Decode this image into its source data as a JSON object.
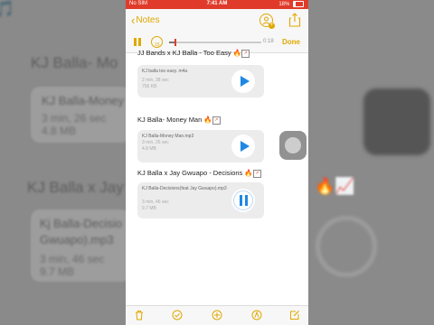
{
  "status_bar": {
    "carrier": "No SIM",
    "time": "7:41 AM",
    "battery": "18%"
  },
  "nav": {
    "back_label": "Notes",
    "icons": [
      "chevron-left-icon",
      "add-person-icon",
      "share-icon"
    ]
  },
  "player": {
    "elapsed": "0:18",
    "done_label": "Done",
    "progress": 0.06
  },
  "note": {
    "top_heading_partial": "JJ Bands x KJ Balla - Too Easy",
    "items": [
      {
        "heading": "",
        "file_name": "KJ balla too easy. m4a",
        "duration": "2 min, 38 sec",
        "size": "756 KB",
        "state": "play"
      },
      {
        "heading": "KJ Balla- Money Man",
        "file_name": "KJ Balla-Money Man.mp3",
        "duration": "3 min, 26 sec",
        "size": "4.8 MB",
        "state": "play"
      },
      {
        "heading": "KJ Balla x Jay Gwuapo - Decisions",
        "file_name": "KJ Balla-Decisions(feat Jay Gwuapo).mp3",
        "duration": "3 min, 46 sec",
        "size": "9.7 MB",
        "state": "playing"
      }
    ]
  },
  "background": {
    "line1": "KJ Balla- Mo",
    "card1_title": "KJ Balla-Money",
    "card1_duration": "3 min, 26 sec",
    "card1_size": "4.8 MB",
    "line2": "KJ Balla x Jay",
    "card2_title": "Kj Balla-Decisio",
    "card2_title2": "Gwuapo).mp3",
    "card2_duration": "3 min, 46 sec",
    "card2_size": "9.7 MB"
  },
  "toolbar": {
    "icons": [
      "trash-icon",
      "checklist-icon",
      "add-icon",
      "markup-icon",
      "compose-icon"
    ]
  },
  "colors": {
    "accent": "#e0a800",
    "status_bar": "#e03b2a",
    "play_button": "#1e88e5"
  }
}
